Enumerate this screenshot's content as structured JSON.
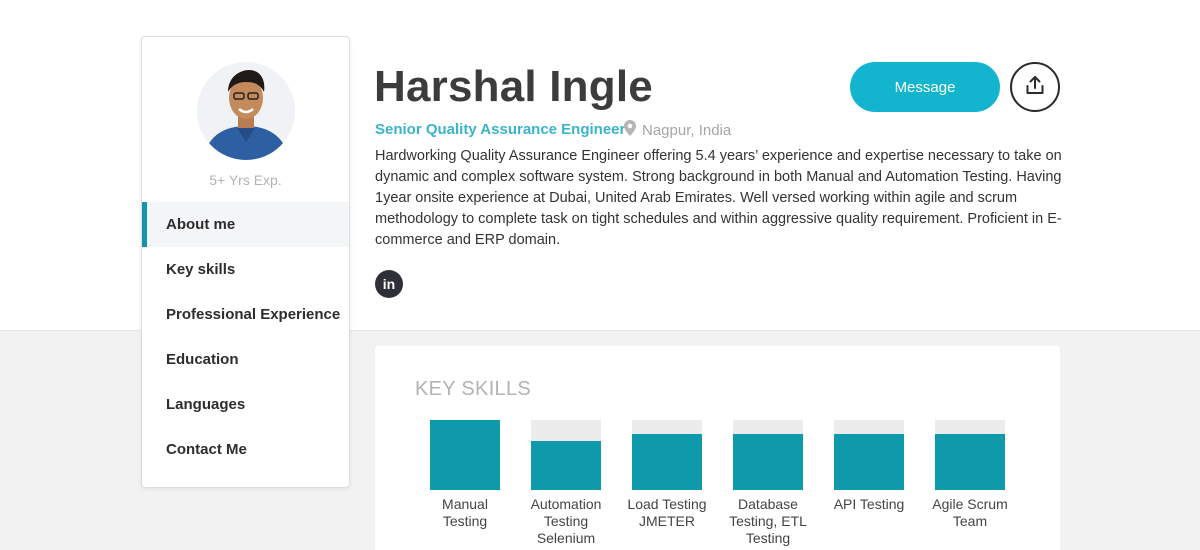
{
  "sidebar": {
    "experience": "5+ Yrs Exp.",
    "nav": [
      {
        "label": "About me",
        "active": true
      },
      {
        "label": "Key skills"
      },
      {
        "label": "Professional Experience"
      },
      {
        "label": "Education"
      },
      {
        "label": "Languages"
      },
      {
        "label": "Contact Me"
      }
    ]
  },
  "profile": {
    "name": "Harshal Ingle",
    "role": "Senior Quality Assurance Engineer",
    "location": "Nagpur, India",
    "about": "Hardworking Quality Assurance Engineer offering 5.4 years’ experience and expertise necessary to take on dynamic and complex software system. Strong background in both Manual and Automation Testing. Having 1year onsite experience at Dubai, United Arab Emirates. Well versed working within agile and scrum methodology to complete task on tight schedules and within aggressive quality requirement. Proficient in E-commerce and ERP domain.",
    "message_label": "Message",
    "linkedin_label": "in"
  },
  "skills": {
    "title": "KEY SKILLS",
    "items": [
      {
        "label": "Manual Testing",
        "level": 1.0
      },
      {
        "label": "Automation Testing Selenium",
        "level": 0.7
      },
      {
        "label": "Load Testing JMETER",
        "level": 0.8
      },
      {
        "label": "Database Testing, ETL Testing",
        "level": 0.8
      },
      {
        "label": "API Testing",
        "level": 0.8
      },
      {
        "label": "Agile Scrum Team",
        "level": 0.8
      }
    ]
  },
  "colors": {
    "accent": "#13b4cd",
    "bar": "#0f9aab",
    "role": "#3ab4c9"
  },
  "icons": {
    "share": "share-upload-icon",
    "location": "location-pin-icon",
    "linkedin": "linkedin-icon"
  }
}
